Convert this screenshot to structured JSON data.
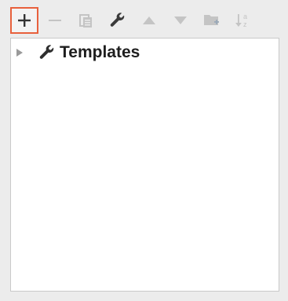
{
  "toolbar": {
    "buttons": [
      {
        "name": "add",
        "icon": "plus-icon",
        "active": true
      },
      {
        "name": "remove",
        "icon": "minus-icon",
        "active": false
      },
      {
        "name": "copy",
        "icon": "copy-icon",
        "active": false
      },
      {
        "name": "edit",
        "icon": "wrench-icon",
        "active": false
      },
      {
        "name": "move-up",
        "icon": "triangle-up-icon",
        "active": false
      },
      {
        "name": "move-down",
        "icon": "triangle-down-icon",
        "active": false
      },
      {
        "name": "add-group",
        "icon": "folder-add-icon",
        "active": false
      },
      {
        "name": "sort",
        "icon": "sort-alpha-icon",
        "active": false
      }
    ]
  },
  "tree": {
    "items": [
      {
        "label": "Templates",
        "icon": "wrench-icon",
        "expanded": false
      }
    ]
  },
  "colors": {
    "highlight_border": "#e8603c",
    "disabled_icon": "#b9b9b9",
    "enabled_icon": "#3a3a3a"
  }
}
